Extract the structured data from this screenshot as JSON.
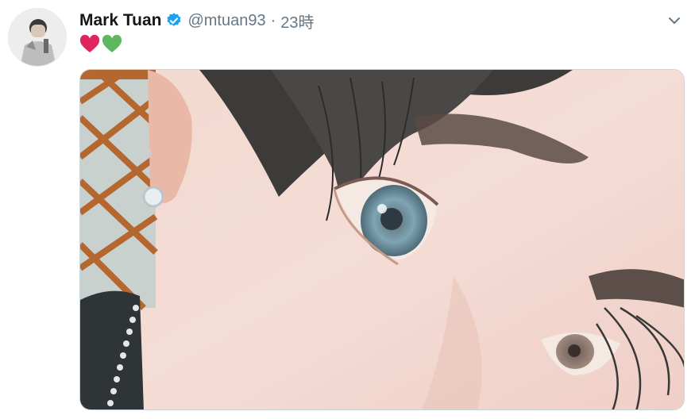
{
  "tweet": {
    "author": {
      "name": "Mark Tuan",
      "handle": "@mtuan93",
      "verified": true,
      "avatar_icon": "avatar-photo"
    },
    "separator": "·",
    "time": "23時",
    "text_emojis": [
      "red-heart",
      "green-heart"
    ],
    "media": {
      "type": "photo",
      "description_icon": "selfie-photo"
    },
    "menu_icon": "chevron-down-icon"
  },
  "colors": {
    "name": "#14171a",
    "secondary": "#657786",
    "verified": "#1da1f2",
    "heart_red": "#e0245e",
    "heart_green": "#5fb85f"
  }
}
